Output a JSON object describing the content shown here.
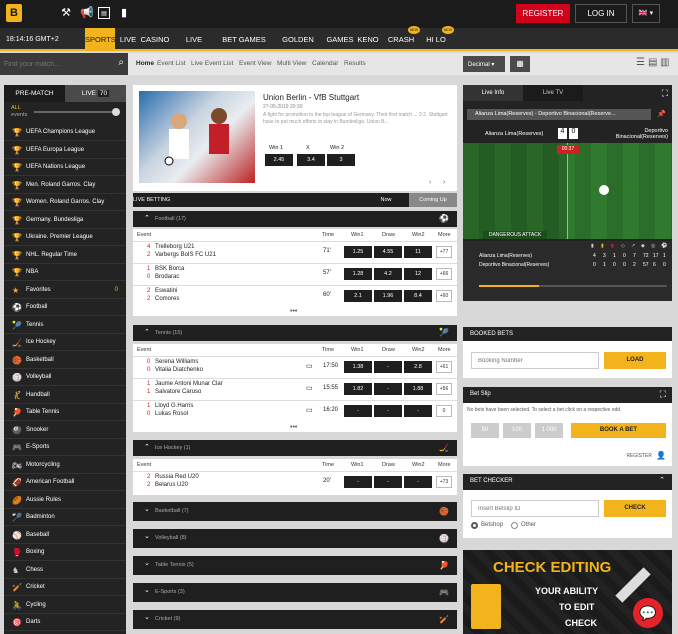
{
  "header": {
    "logo": "B",
    "register": "REGISTER",
    "login": "LOG IN",
    "lang": "🇬🇧 ▾"
  },
  "nav": {
    "time": "18:14:16  GMT+2",
    "items": [
      "SPORTS",
      "LIVE",
      "CASINO",
      "LIVE CASINO",
      "BET GAMES TV",
      "GOLDEN RACE",
      "GAMES",
      "KENO",
      "CRASH",
      "HI LO"
    ],
    "badge": "NEW"
  },
  "search": {
    "placeholder": "Find your match..."
  },
  "subnav": {
    "items": [
      "Home",
      "Event List",
      "Live Event List",
      "Event View",
      "Multi View",
      "Calendar",
      "Results"
    ],
    "odds_format": "Decimal"
  },
  "sidebar": {
    "tab_prematch": "PRE-MATCH",
    "tab_live": "LIVE",
    "live_count": "70",
    "all_label": "ALL",
    "events_label": "events",
    "items": [
      {
        "label": "UEFA Champions League",
        "icon": "trophy-icon"
      },
      {
        "label": "UEFA Europa League",
        "icon": "trophy-icon"
      },
      {
        "label": "UEFA Nations League",
        "icon": "trophy-icon"
      },
      {
        "label": "Men. Roland Garros. Clay",
        "icon": "trophy-icon"
      },
      {
        "label": "Women. Roland Garros. Clay",
        "icon": "trophy-icon"
      },
      {
        "label": "Germany. Bundesliga",
        "icon": "trophy-icon"
      },
      {
        "label": "Ukraine. Premier League",
        "icon": "trophy-icon"
      },
      {
        "label": "NHL. Regular Time",
        "icon": "trophy-icon"
      },
      {
        "label": "NBA",
        "icon": "trophy-icon"
      },
      {
        "label": "Favorites",
        "icon": "star-icon",
        "count": "0"
      },
      {
        "label": "Football",
        "icon": "football-icon"
      },
      {
        "label": "Tennis",
        "icon": "tennis-icon"
      },
      {
        "label": "Ice Hockey",
        "icon": "hockey-icon"
      },
      {
        "label": "Basketball",
        "icon": "basketball-icon"
      },
      {
        "label": "Volleyball",
        "icon": "volleyball-icon"
      },
      {
        "label": "Handball",
        "icon": "handball-icon"
      },
      {
        "label": "Table Tennis",
        "icon": "table-tennis-icon"
      },
      {
        "label": "Snooker",
        "icon": "snooker-icon"
      },
      {
        "label": "E-Sports",
        "icon": "gamepad-icon"
      },
      {
        "label": "Motorcycling",
        "icon": "motorcycle-icon"
      },
      {
        "label": "American Football",
        "icon": "american-football-icon"
      },
      {
        "label": "Aussie Rules",
        "icon": "aussie-rules-icon"
      },
      {
        "label": "Badminton",
        "icon": "badminton-icon"
      },
      {
        "label": "Baseball",
        "icon": "baseball-icon"
      },
      {
        "label": "Boxing",
        "icon": "boxing-icon"
      },
      {
        "label": "Chess",
        "icon": "chess-icon"
      },
      {
        "label": "Cricket",
        "icon": "cricket-icon"
      },
      {
        "label": "Cycling",
        "icon": "cycling-icon"
      },
      {
        "label": "Darts",
        "icon": "darts-icon"
      }
    ]
  },
  "featured": {
    "title": "Union Berlin - VfB Stuttgart",
    "date": "27-05-2019 20:30",
    "desc": "A fight for promotion to the top league of Germany. Their first match ... 2:2. Stuttgart have to put much efforts to stay in Bundesliga. Union B...",
    "odds": [
      {
        "label": "Win 1",
        "value": "2.45"
      },
      {
        "label": "X",
        "value": "3.4"
      },
      {
        "label": "Win 2",
        "value": "3"
      }
    ]
  },
  "livebetting": {
    "title": "LIVE BETTING",
    "tab_now": "Now",
    "tab_coming": "Coming Up"
  },
  "columns": {
    "event": "Event",
    "time": "Time",
    "win1": "Win1",
    "draw": "Draw",
    "win2": "Win2",
    "more": "More"
  },
  "football": {
    "title": "Football",
    "count": "(17)",
    "rows": [
      {
        "s1": "4",
        "t1": "Trelleborg U21",
        "s2": "2",
        "t2": "Varbergs BoIS FC U21",
        "time": "71'",
        "w1": "1.25",
        "x": "4.55",
        "w2": "11",
        "more": "+77"
      },
      {
        "s1": "1",
        "t1": "BSK Borca",
        "s2": "0",
        "t2": "Brodarac",
        "time": "57'",
        "w1": "1.28",
        "x": "4.2",
        "w2": "12",
        "more": "+66"
      },
      {
        "s1": "2",
        "t1": "Eswatini",
        "s2": "2",
        "t2": "Comores",
        "time": "60'",
        "w1": "2.1",
        "x": "1.96",
        "w2": "8.4",
        "more": "+60"
      }
    ]
  },
  "tennis": {
    "title": "Tennis",
    "count": "(15)",
    "rows": [
      {
        "s1": "0",
        "t1": "Serena Williams",
        "s2": "0",
        "t2": "Vitalia Diatchenko",
        "time": "17:50",
        "w1": "1.38",
        "x": "-",
        "w2": "2.8",
        "more": "+61"
      },
      {
        "s1": "1",
        "t1": "Jaume Antoni Munar Clar",
        "s2": "1",
        "t2": "Salvatore Caruso",
        "time": "15:55",
        "w1": "1.82",
        "x": "-",
        "w2": "1.88",
        "more": "+56"
      },
      {
        "s1": "1",
        "t1": "Lloyd G.Harris",
        "s2": "0",
        "t2": "Lukas Rosol",
        "time": "16:20",
        "w1": "-",
        "x": "-",
        "w2": "-",
        "more": "0"
      }
    ]
  },
  "icehockey": {
    "title": "Ice Hockey",
    "count": "(1)",
    "rows": [
      {
        "s1": "2",
        "t1": "Russia Red U20",
        "s2": "2",
        "t2": "Belarus U20",
        "time": "20'",
        "w1": "-",
        "x": "-",
        "w2": "-",
        "more": "+73"
      }
    ]
  },
  "collapsed": [
    {
      "title": "Basketball",
      "count": "(7)"
    },
    {
      "title": "Volleyball",
      "count": "(8)"
    },
    {
      "title": "Table Tennis",
      "count": "(5)"
    },
    {
      "title": "E-Sports",
      "count": "(3)"
    },
    {
      "title": "Cricket",
      "count": "(9)"
    }
  ],
  "liveinfo": {
    "tab_info": "Live Info",
    "tab_tv": "Live TV",
    "match": "Alianza Lima(Reserves) - Deportivo Binacional(Reserve...",
    "team1": "Alianza Lima(Reserves)",
    "score1": "4",
    "score2": "0",
    "team2": "Deportivo Binacional(Reserves)",
    "clock": "00:37",
    "attack": "DANGEROUS ATTACK",
    "stats": [
      {
        "team": "Alianza Lima(Reserves)",
        "vals": [
          "4",
          "3",
          "1",
          "0",
          "7",
          "72",
          "17",
          "1"
        ]
      },
      {
        "team": "Deportivo Binacional(Reserves)",
        "vals": [
          "0",
          "1",
          "0",
          "0",
          "2",
          "57",
          "6",
          "0"
        ]
      }
    ]
  },
  "booked": {
    "title": "BOOKED BETS",
    "placeholder": "Booking Number",
    "load": "LOAD"
  },
  "betslip": {
    "title": "Bet Slip",
    "msg": "No bets have been selected. To select a bet click on a respective odd.",
    "amounts": [
      "50",
      "100",
      "1 000"
    ],
    "book": "BOOK A BET",
    "register": "REGISTER"
  },
  "checker": {
    "title": "BET CHECKER",
    "placeholder": "Insert Betslip ID",
    "check": "CHECK",
    "opt1": "Betshop",
    "opt2": "Other"
  },
  "promo": {
    "l1": "CHECK EDITING",
    "l2": "YOUR ABILITY",
    "l3": "TO EDIT",
    "l4": "CHECK"
  },
  "colors": {
    "accent": "#f2b31c",
    "register": "#d0021b",
    "dark": "#1f1f1f"
  }
}
